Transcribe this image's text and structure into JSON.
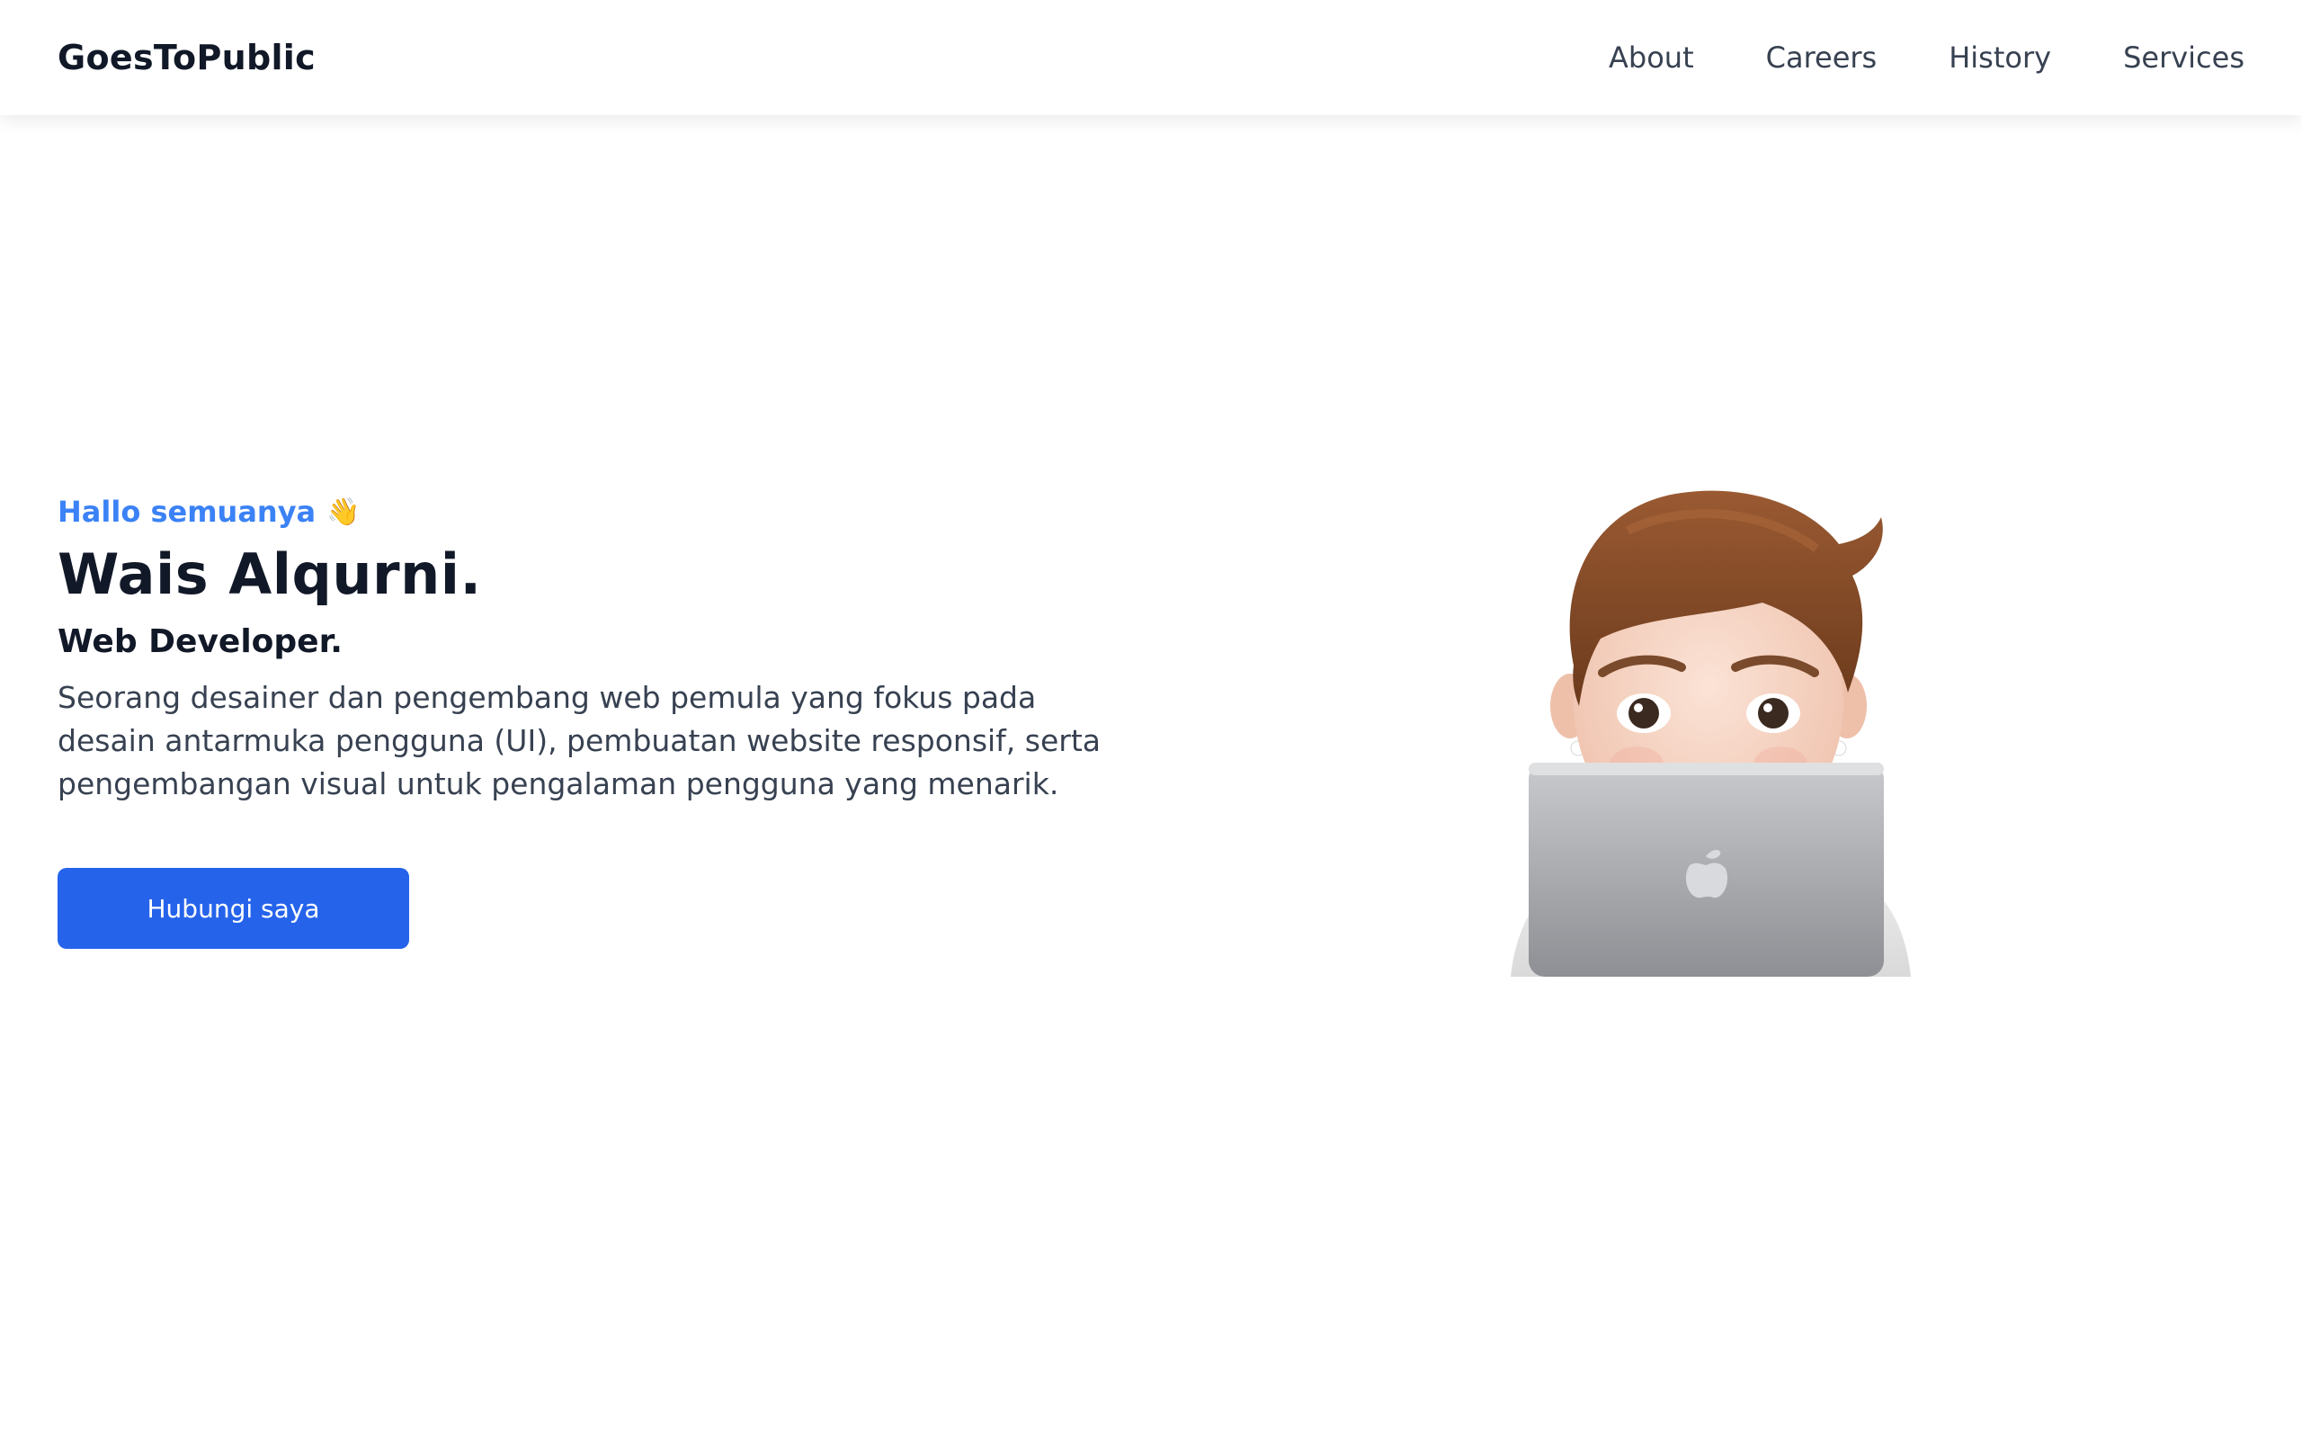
{
  "navbar": {
    "brand": "GoesToPublic",
    "links": [
      {
        "label": "About"
      },
      {
        "label": "Careers"
      },
      {
        "label": "History"
      },
      {
        "label": "Services"
      }
    ]
  },
  "hero": {
    "greeting": "Hallo semuanya",
    "greeting_icon": "waving-hand-icon",
    "name": "Wais Alqurni.",
    "role": "Web Developer.",
    "description": "Seorang desainer dan pengembang web pemula yang fokus pada desain antarmuka pengguna (UI), pembuatan website responsif, serta pengembangan visual untuk pengalaman pengguna yang menarik.",
    "cta_label": "Hubungi saya"
  },
  "colors": {
    "accent": "#3b82f6",
    "button": "#2563eb",
    "heading": "#111827",
    "body_text": "#374151"
  },
  "illustration": {
    "icon": "memoji-laptop-illustration"
  }
}
